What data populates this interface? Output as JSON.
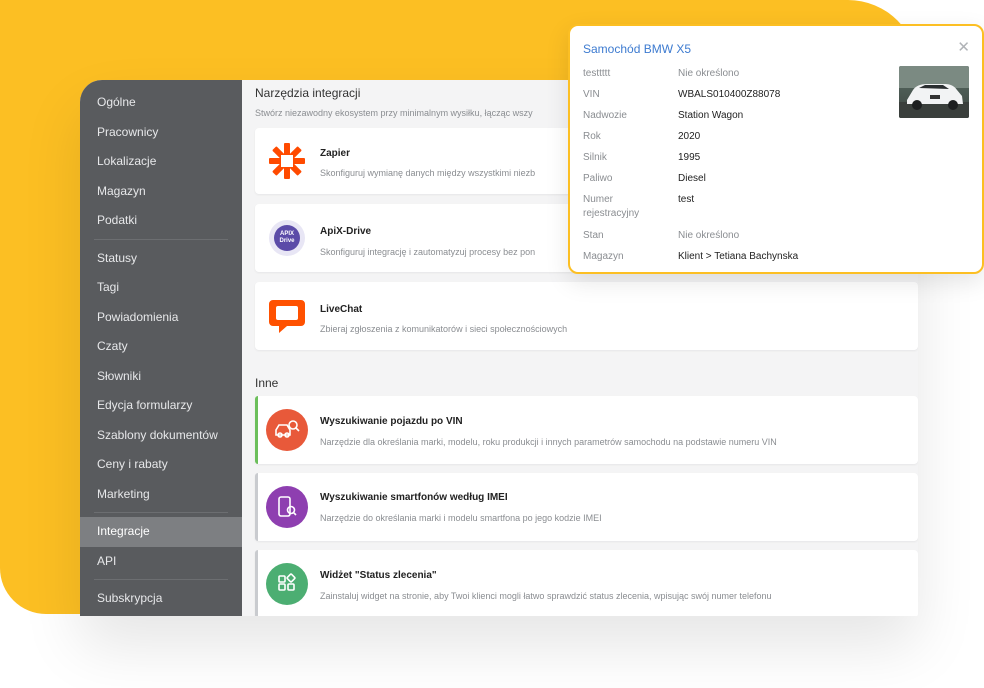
{
  "sidebar": {
    "items": [
      {
        "label": "Ogólne"
      },
      {
        "label": "Pracownicy"
      },
      {
        "label": "Lokalizacje"
      },
      {
        "label": "Magazyn"
      },
      {
        "label": "Podatki"
      },
      {
        "label": "Statusy"
      },
      {
        "label": "Tagi"
      },
      {
        "label": "Powiadomienia"
      },
      {
        "label": "Czaty"
      },
      {
        "label": "Słowniki"
      },
      {
        "label": "Edycja formularzy"
      },
      {
        "label": "Szablony dokumentów"
      },
      {
        "label": "Ceny i rabaty"
      },
      {
        "label": "Marketing"
      },
      {
        "label": "Integracje"
      },
      {
        "label": "API"
      },
      {
        "label": "Subskrypcja"
      }
    ],
    "active": "Integracje"
  },
  "main": {
    "title": "Narzędzia integracji",
    "description": "Stwórz niezawodny ekosystem przy minimalnym wysiłku, łącząc wszy",
    "integrations": [
      {
        "title": "Zapier",
        "desc": "Skonfiguruj wymianę danych między wszystkimi niezb",
        "icon": "zapier-icon"
      },
      {
        "title": "ApiX-Drive",
        "desc": "Skonfiguruj integrację i zautomatyzuj procesy bez pon",
        "icon": "apix-drive-icon",
        "icon_text": "APIX Drive"
      },
      {
        "title": "LiveChat",
        "desc": "Zbieraj zgłoszenia z komunikatorów i sieci społecznościowych",
        "icon": "livechat-icon"
      }
    ],
    "other_title": "Inne",
    "other": [
      {
        "title": "Wyszukiwanie pojazdu po VIN",
        "desc": "Narzędzie dla określania marki, modelu, roku produkcji i innych parametrów samochodu na podstawie numeru VIN",
        "icon": "car-search-icon",
        "color": "#e8593a",
        "accent": "#6cbf5b"
      },
      {
        "title": "Wyszukiwanie smartfonów według IMEI",
        "desc": "Narzędzie do określania marki i modelu smartfona po jego kodzie IMEI",
        "icon": "phone-search-icon",
        "color": "#8e3fb0",
        "accent": "#c9cbcf"
      },
      {
        "title": "Widżet \"Status zlecenia\"",
        "desc": "Zainstaluj widget na stronie, aby Twoi klienci mogli łatwo sprawdzić status zlecenia, wpisując swój numer telefonu",
        "icon": "widget-icon",
        "color": "#4cae72",
        "accent": "#c9cbcf"
      }
    ]
  },
  "popup": {
    "title": "Samochód BMW X5",
    "rows": [
      {
        "label": "testtttt",
        "value": "Nie określono",
        "muted": true
      },
      {
        "label": "VIN",
        "value": "WBALS010400Z88078"
      },
      {
        "label": "Nadwozie",
        "value": "Station Wagon"
      },
      {
        "label": "Rok",
        "value": "2020"
      },
      {
        "label": "Silnik",
        "value": "1995"
      },
      {
        "label": "Paliwo",
        "value": "Diesel"
      },
      {
        "label": "Numer rejestracyjny",
        "value": "test"
      },
      {
        "label": "Stan",
        "value": "Nie określono",
        "muted": true
      },
      {
        "label": "Magazyn",
        "value": "Klient > Tetiana Bachynska"
      }
    ]
  },
  "colors": {
    "background_accent": "#fcbf23",
    "sidebar": "#595b5e",
    "popup_title": "#3d7bd0",
    "zapier": "#ff4a00",
    "livechat": "#ff5100"
  }
}
